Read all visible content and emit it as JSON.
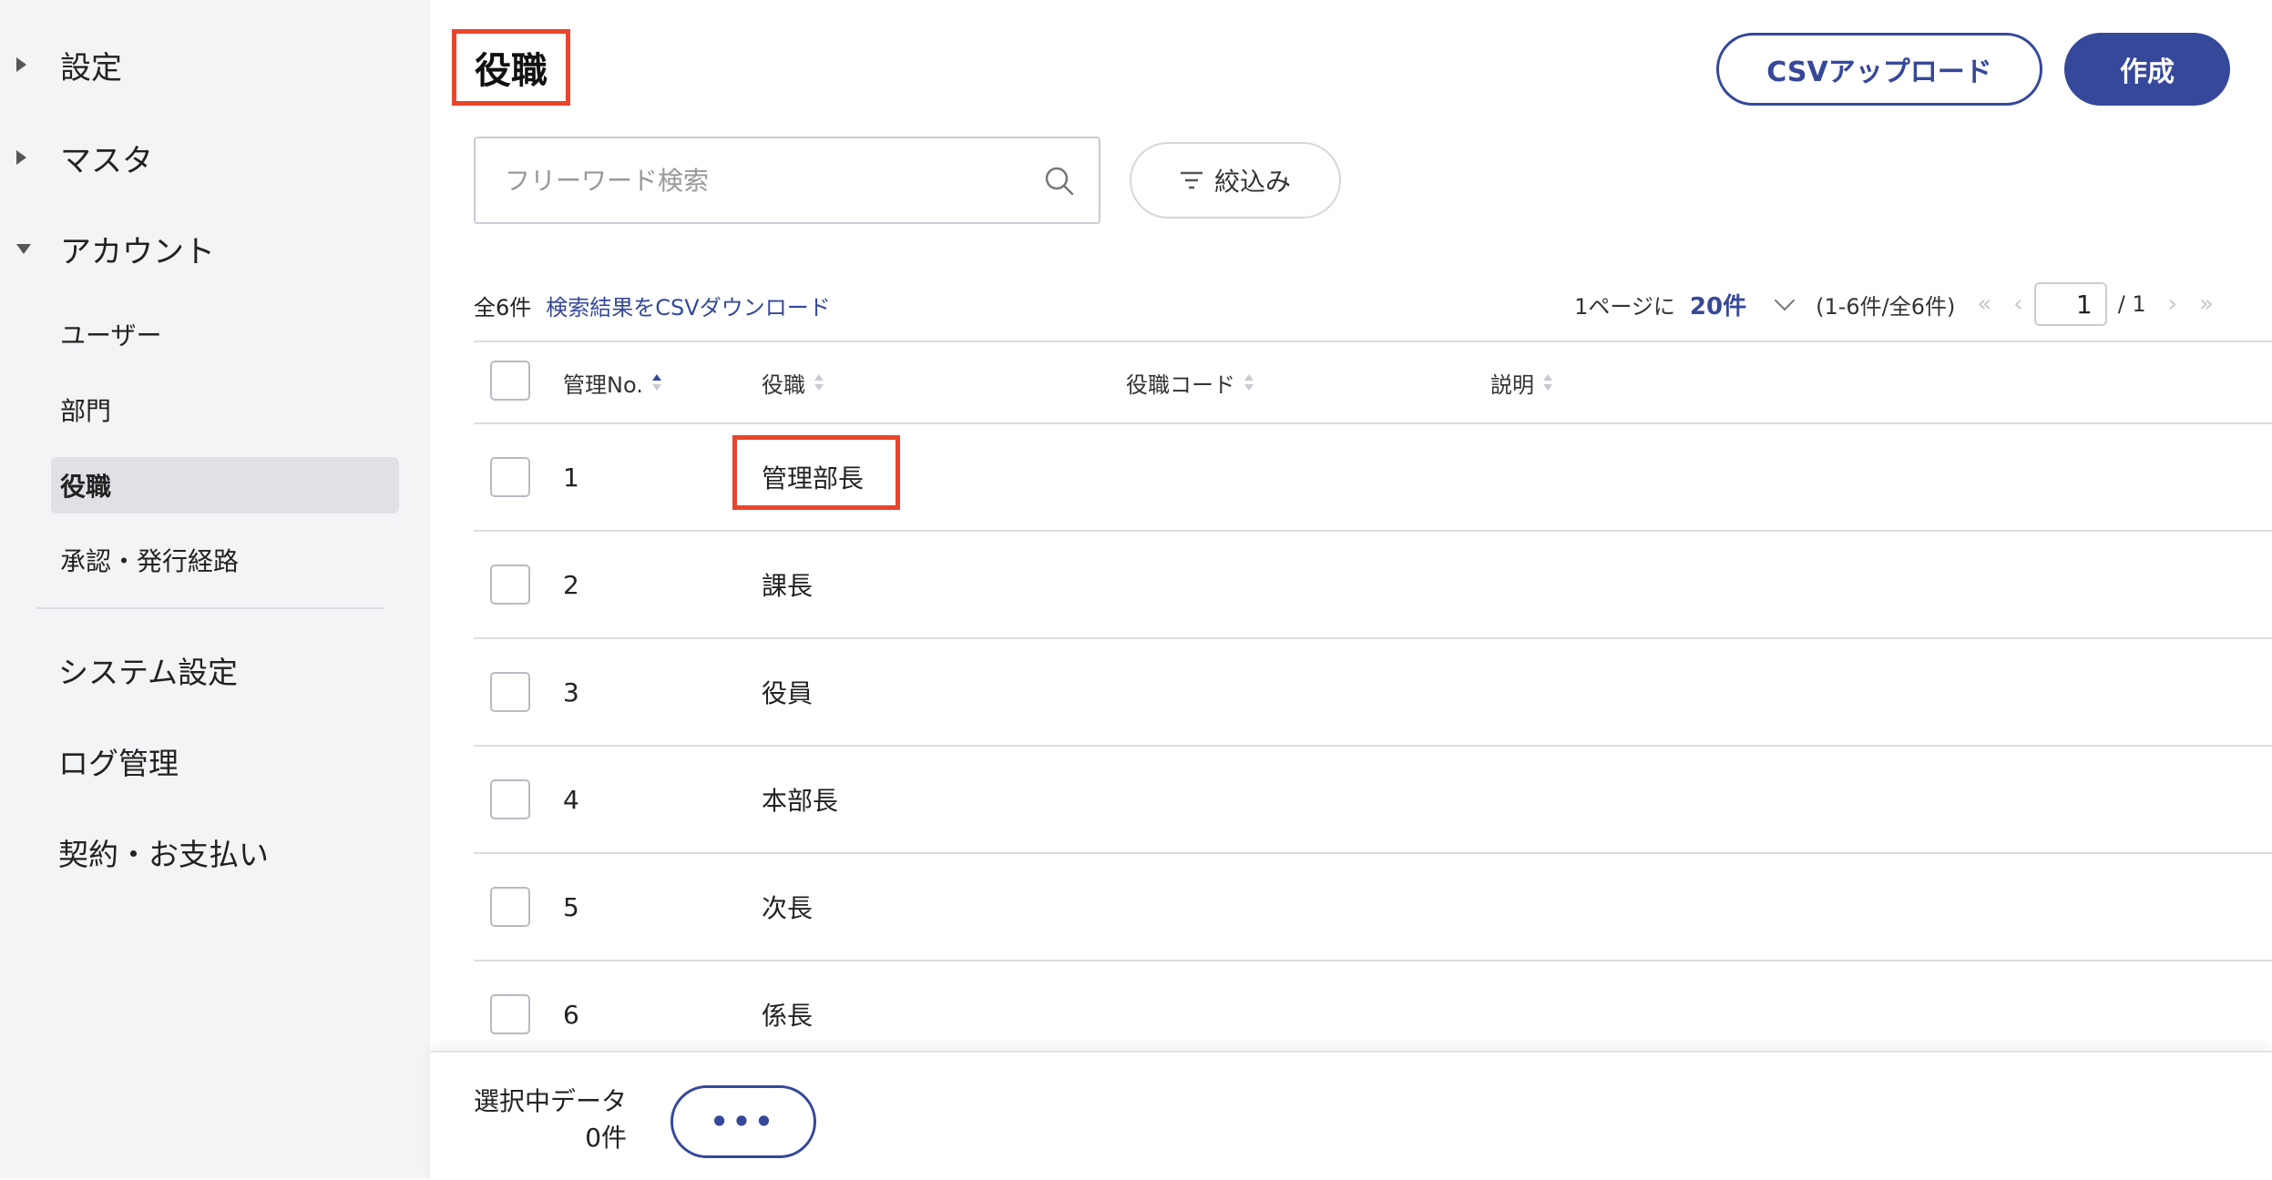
{
  "sidebar": {
    "groups": [
      {
        "label": "設定",
        "expanded": false
      },
      {
        "label": "マスタ",
        "expanded": false
      },
      {
        "label": "アカウント",
        "expanded": true
      }
    ],
    "account_items": [
      {
        "label": "ユーザー",
        "active": false
      },
      {
        "label": "部門",
        "active": false
      },
      {
        "label": "役職",
        "active": true
      },
      {
        "label": "承認・発行経路",
        "active": false
      }
    ],
    "links": [
      "システム設定",
      "ログ管理",
      "契約・お支払い"
    ]
  },
  "header": {
    "title": "役職",
    "csv_upload_label": "CSVアップロード",
    "create_label": "作成"
  },
  "search": {
    "placeholder": "フリーワード検索",
    "filter_label": "絞込み"
  },
  "results": {
    "total_label": "全6件",
    "csv_download_label": "検索結果をCSVダウンロード"
  },
  "pagination": {
    "per_page_prefix": "1ページに",
    "per_page_value": "20件",
    "range_label": "(1-6件/全6件)",
    "current_page": "1",
    "total_pages_label": "/ 1"
  },
  "table": {
    "columns": [
      "管理No.",
      "役職",
      "役職コード",
      "説明"
    ],
    "rows": [
      {
        "no": "1",
        "role": "管理部長"
      },
      {
        "no": "2",
        "role": "課長"
      },
      {
        "no": "3",
        "role": "役員"
      },
      {
        "no": "4",
        "role": "本部長"
      },
      {
        "no": "5",
        "role": "次長"
      },
      {
        "no": "6",
        "role": "係長"
      }
    ]
  },
  "footer": {
    "selected_label": "選択中データ",
    "selected_count": "0件",
    "more_label": "•••"
  },
  "colors": {
    "accent": "#35489a",
    "highlight": "#e8452c",
    "sidebar_bg": "#f3f4f6"
  }
}
